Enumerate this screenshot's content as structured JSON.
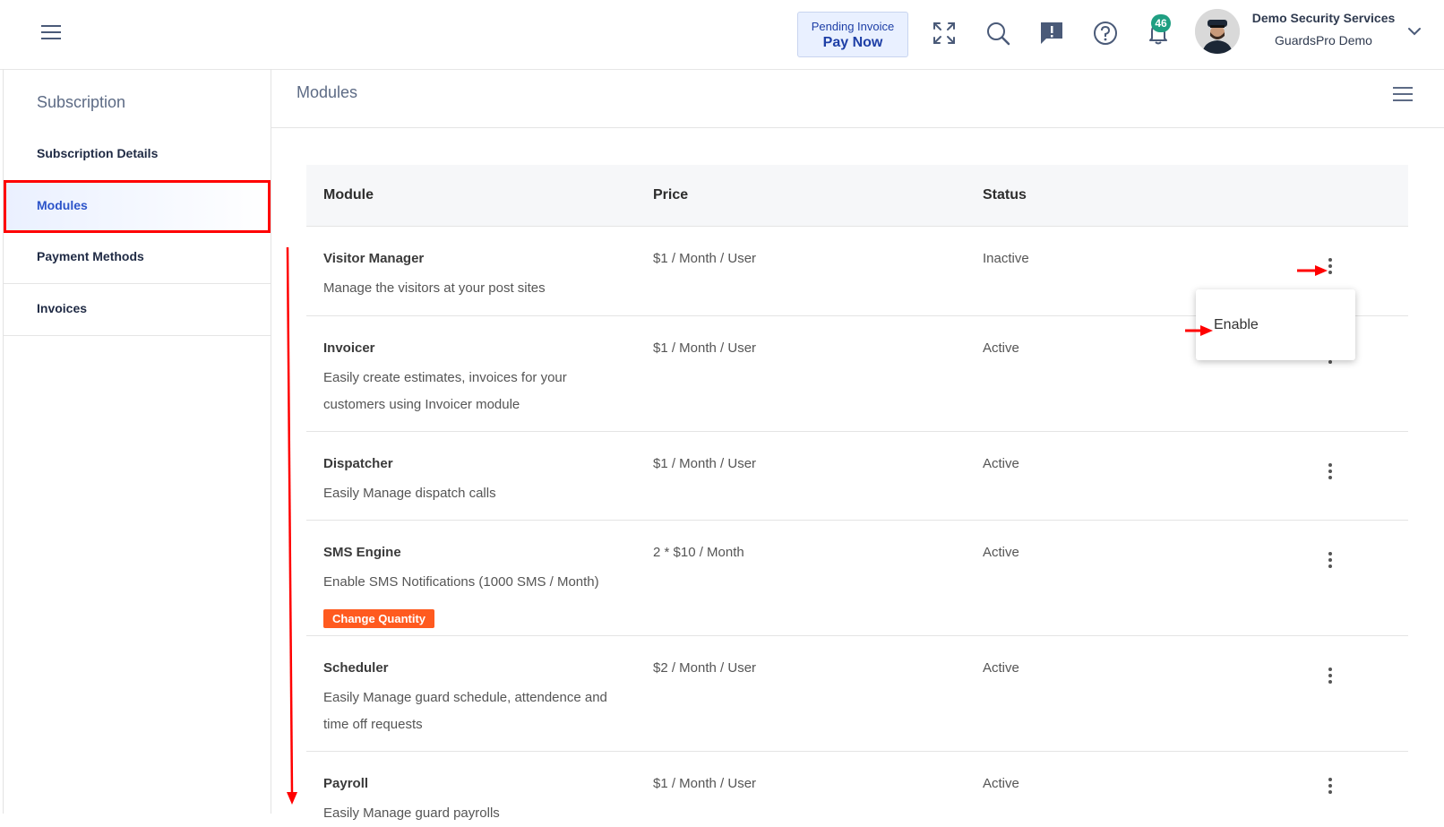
{
  "topbar": {
    "pending_line1": "Pending Invoice",
    "pending_line2": "Pay Now",
    "notification_count": "46",
    "company_name": "Demo Security Services",
    "user_name": "GuardsPro Demo"
  },
  "sidebar": {
    "title": "Subscription",
    "items": [
      {
        "label": "Subscription Details",
        "active": false
      },
      {
        "label": "Modules",
        "active": true
      },
      {
        "label": "Payment Methods",
        "active": false
      },
      {
        "label": "Invoices",
        "active": false
      }
    ]
  },
  "main": {
    "title": "Modules",
    "columns": [
      "Module",
      "Price",
      "Status"
    ],
    "rows": [
      {
        "name": "Visitor Manager",
        "description": "Manage the visitors at your post sites",
        "price": "$1 / Month / User",
        "status": "Inactive"
      },
      {
        "name": "Invoicer",
        "description": "Easily create estimates, invoices for your customers using Invoicer module",
        "price": "$1 / Month / User",
        "status": "Active"
      },
      {
        "name": "Dispatcher",
        "description": "Easily Manage dispatch calls",
        "price": "$1 / Month / User",
        "status": "Active"
      },
      {
        "name": "SMS Engine",
        "description": "Enable SMS Notifications (1000 SMS / Month)",
        "price": "2 * $10 / Month",
        "status": "Active",
        "action_label": "Change Quantity"
      },
      {
        "name": "Scheduler",
        "description": "Easily Manage guard schedule, attendence and time off requests",
        "price": "$2 / Month / User",
        "status": "Active"
      },
      {
        "name": "Payroll",
        "description": "Easily Manage guard payrolls",
        "price": "$1 / Month / User",
        "status": "Active"
      }
    ],
    "dropdown_option": "Enable"
  },
  "colors": {
    "accent": "#2c54c9",
    "annotation": "#ff0000",
    "badge": "#1f9f82",
    "change_quantity": "#ff5a1f"
  }
}
